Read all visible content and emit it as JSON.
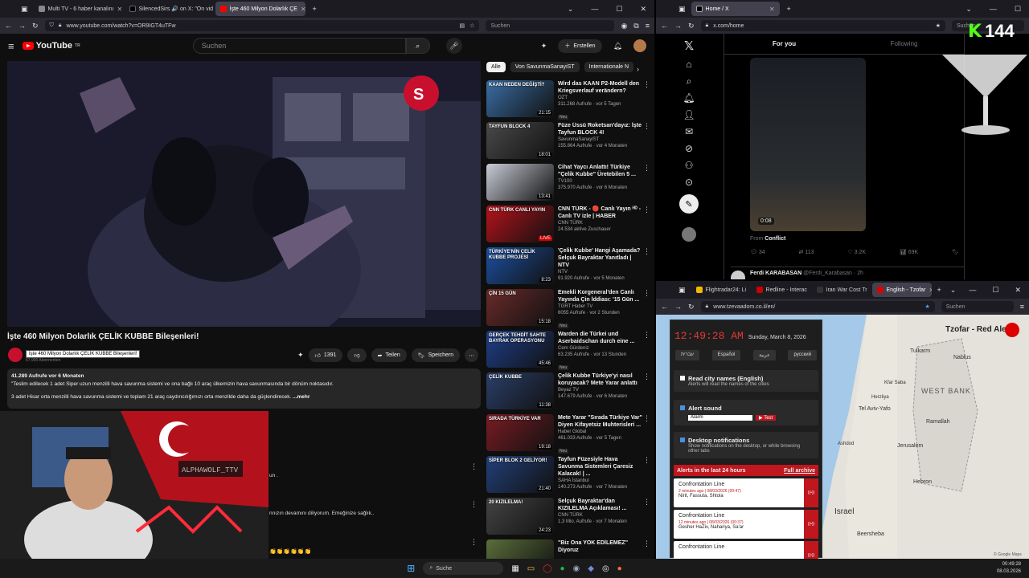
{
  "left_browser": {
    "tabs": [
      {
        "label": "Multi TV - 6 haber kanalını",
        "active": false
      },
      {
        "label": "SilencedSirs 🔊 on X: \"On video",
        "active": false
      },
      {
        "label": "İşte 460 Milyon Dolarlık ÇE",
        "active": true
      }
    ],
    "url": "www.youtube.com/watch?v=OR9IGT4uTFw",
    "search_placeholder": "Suchen"
  },
  "youtube": {
    "logo": "YouTube",
    "logo_sup": "TR",
    "search_placeholder": "Suchen",
    "create_label": "Erstellen",
    "video_title": "İşte 460 Milyon Dolarlık ÇELİK KUBBE Bileşenleri!",
    "tooltip": "İşte 460 Milyon Dolarlık ÇELİK KUBBE Bileşenleri!",
    "channel_subs": "67.900 Abonnenten",
    "likes": "1391",
    "share_label": "Teilen",
    "save_label": "Speichern",
    "desc_stats": "41.289 Aufrufe  vor 6 Monaten",
    "desc_line1": "\"Teslim edilecek 1 adet Siper uzun menzilli hava savunma sistemi ve ona bağlı 10 araç ülkemizin hava savunmasında bir dönüm noktasıdır.",
    "desc_line2": "3 adet Hisar orta menzilli hava savunma sistemi ve toplam 21 araç caydırıcılığımızı orta menzilde daha da güçlendirecek.",
    "desc_more": "...mehr",
    "comment_frag1": "un .",
    "comment_frag2": "nnızın devamını diliyorum. Emeğinize sağlık..",
    "comment_emojis": "👏👏👏👏👏👏",
    "overlay_tag": "ALPHAWOLF_TTV",
    "chips": [
      "Alle",
      "Von SavunmaSanayiST",
      "Internationale N"
    ],
    "recs": [
      {
        "title": "Wird das KAAN P2-Modell den Kriegsverlauf verändern?",
        "channel": "OZT",
        "meta": "311.268 Aufrufe · vor 5 Tagen",
        "badge": "Neu",
        "dur": "21:15",
        "thumb_text": "KAAN NEDEN DEĞİŞTİ?",
        "color": "#3a6ea5"
      },
      {
        "title": "Füze Üssü Roketsan'dayız: İşte Tayfun BLOCK 4!",
        "channel": "SavunmaSanayiST",
        "meta": "155.864 Aufrufe · vor 4 Monaten",
        "badge": "",
        "dur": "18:01",
        "thumb_text": "TAYFUN BLOCK 4",
        "color": "#4a4a4a"
      },
      {
        "title": "Cihat Yaycı Anlattı! Türkiye \"Çelik Kubbe\" Üretebilen 5 ...",
        "channel": "TV100",
        "meta": "375.970 Aufrufe · vor 6 Monaten",
        "badge": "",
        "dur": "13:41",
        "thumb_text": "",
        "color": "#c8ccd6"
      },
      {
        "title": "CNN TÜRK - 🔴 Canlı Yayın ᴴᴰ - Canlı TV izle | HABER",
        "channel": "CNN TÜRK",
        "meta": "24.534 aktive Zuschauer",
        "badge": "",
        "dur": "LIVE",
        "thumb_text": "CNN TÜRK CANLI YAYIN",
        "color": "#b5121b"
      },
      {
        "title": "'Çelik Kubbe' Hangi Aşamada? Selçuk Bayraktar Yanıtladı | NTV",
        "channel": "NTV",
        "meta": "91.920 Aufrufe · vor 5 Monaten",
        "badge": "",
        "dur": "8:23",
        "thumb_text": "TÜRKİYE'NİN ÇELİK KUBBE PROJESİ",
        "color": "#1c4fa0"
      },
      {
        "title": "Emekli Korgeneral'den Canlı Yayında Çin İddiası: '15 Gün ...",
        "channel": "TGRT Haber TV",
        "meta": "6055 Aufrufe · vor 2 Stunden",
        "badge": "Neu",
        "dur": "15:18",
        "thumb_text": "ÇİN 15 GÜN",
        "color": "#6b2a2a"
      },
      {
        "title": "Warden die Türkei und Aserbaidschan durch eine ...",
        "channel": "Cem Gürdeniz",
        "meta": "63.235 Aufrufe · vor 13 Stunden",
        "badge": "Neu",
        "dur": "45:46",
        "thumb_text": "GERÇEK TEHDİT SAHTE BAYRAK OPERASYONU",
        "color": "#1f3f8a"
      },
      {
        "title": "Çelik Kubbe Türkiye'yi nasıl koruyacak? Mete Yarar anlattı",
        "channel": "Beyaz TV",
        "meta": "147.679 Aufrufe · vor 6 Monaten",
        "badge": "",
        "dur": "11:38",
        "thumb_text": "ÇELİK KUBBE",
        "color": "#2b3f6a"
      },
      {
        "title": "Mete Yarar \"Sırada Türkiye Var\" Diyen Kifayetsiz Muhterisleri ...",
        "channel": "Haber Global",
        "meta": "461.033 Aufrufe · vor 5 Tagen",
        "badge": "Neu",
        "dur": "19:18",
        "thumb_text": "SIRADA TÜRKİYE VAR",
        "color": "#7a1c24"
      },
      {
        "title": "Tayfun Füzesiyle Hava Savunma Sistemleri Çaresiz Kalacak! | ...",
        "channel": "SAHA İstanbul",
        "meta": "140.273 Aufrufe · vor 7 Monaten",
        "badge": "",
        "dur": "21:40",
        "thumb_text": "SİPER BLOK 2 GELİYOR!",
        "color": "#22407a"
      },
      {
        "title": "Selçuk Bayraktar'dan KIZILELMA Açıklaması! ...",
        "channel": "CNN TÜRK",
        "meta": "1,3 Mio. Aufrufe · vor 7 Monaten",
        "badge": "",
        "dur": "24:23",
        "thumb_text": "20 KIZILELMA!",
        "color": "#444"
      },
      {
        "title": "\"Biz Ona YOK EDİLEMEZ\" Diyoruz",
        "channel": "",
        "meta": "",
        "badge": "",
        "dur": "",
        "thumb_text": "",
        "color": "#5a6e3a"
      }
    ]
  },
  "x_browser": {
    "tab": "Home / X",
    "url": "x.com/home",
    "search_placeholder": "Suchen",
    "tab_for_you": "For you",
    "tab_following": "Following",
    "video_time": "0:08",
    "from_label": "From",
    "from_name": "Conflict",
    "counts": [
      "34",
      "113",
      "3.2K",
      "69K"
    ],
    "next_author": "Ferdi KARABASAN",
    "next_handle": "@Ferdi_Karabasan · 2h",
    "kick_count": "144"
  },
  "tzofar_browser": {
    "tabs": [
      {
        "label": "Flightradar24: Li",
        "active": false
      },
      {
        "label": "Redline - Interac",
        "active": false
      },
      {
        "label": "Iran War Cost Tr",
        "active": false
      },
      {
        "label": "English - Tzofar",
        "active": true
      }
    ],
    "url": "www.tzevaadom.co.il/en/",
    "search_placeholder": "Suchen",
    "clock": "12:49:28 AM",
    "date": "Sunday, March 8, 2026",
    "languages": [
      "עברית",
      "Español",
      "عربية",
      "русский"
    ],
    "read_names_title": "Read city names (English)",
    "read_names_desc": "Alerts will read the names of the cities",
    "alert_sound_title": "Alert sound",
    "alert_sound_value": "Alarm",
    "test_label": "Test",
    "desktop_title": "Desktop notifications",
    "desktop_desc": "Show notifications on the desktop, or while browsing other tabs",
    "alerts_header": "Alerts in the last 24 hours",
    "full_archive": "Full archive",
    "alerts": [
      {
        "title": "Confrontation Line",
        "time": "2 minutes ago | 08/03/2026 (00:47)",
        "cities": "Nirit, Fassuta, Shtola"
      },
      {
        "title": "Confrontation Line",
        "time": "12 minutes ago | 08/03/2026 (00:37)",
        "cities": "Gesher HaZiv, Nahariya, Sa'ar"
      },
      {
        "title": "Confrontation Line",
        "time": "",
        "cities": ""
      }
    ],
    "map_title": "Tzofar - Red Alert",
    "map_labels": [
      "Tulkarm",
      "Nablus",
      "Kfar Saba",
      "Herzliya",
      "Tel Aviv-Yafo",
      "Ramallah",
      "Jerusalem",
      "Hebron",
      "WEST BANK",
      "Israel",
      "Ashdod",
      "Beersheba"
    ],
    "map_credit": "© Google Maps"
  },
  "taskbar": {
    "search_label": "Suche",
    "time": "00:49:28",
    "date": "08.03.2026"
  }
}
